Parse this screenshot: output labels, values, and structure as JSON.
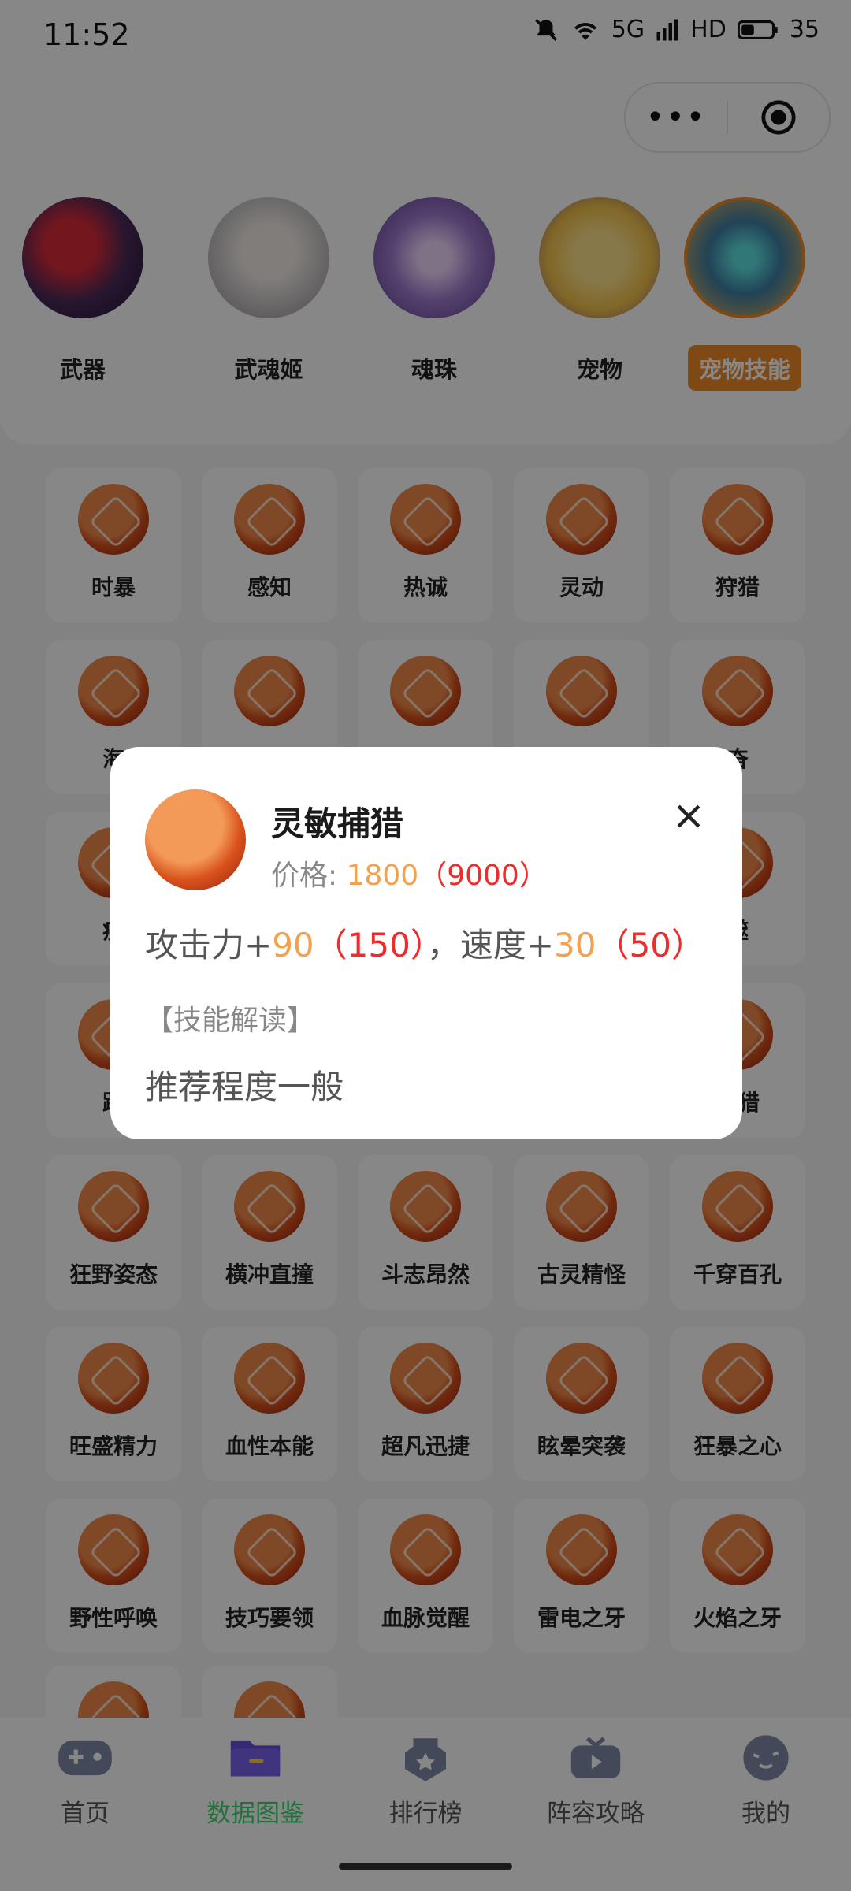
{
  "status": {
    "time": "11:52",
    "network": "5G",
    "hd": "HD",
    "battery": "35"
  },
  "navbar": {
    "more_icon": "more-dots-icon",
    "target_icon": "target-icon"
  },
  "categories": [
    {
      "label": "武器",
      "color": "#4a2a5a"
    },
    {
      "label": "武魂姬",
      "color": "#c9c4c6"
    },
    {
      "label": "魂珠",
      "color": "#a07bd0"
    },
    {
      "label": "宠物",
      "color": "#f3c24a"
    },
    {
      "label": "宠物技能",
      "color": "#3f7fa3",
      "active": true
    }
  ],
  "skills": [
    [
      "时暴",
      "感知",
      "热诚",
      "灵动",
      "狩猎"
    ],
    [
      "海",
      "",
      "",
      "",
      "奋"
    ],
    [
      "疾",
      "",
      "",
      "",
      "噬"
    ],
    [
      "践",
      "",
      "",
      "",
      "捕猎"
    ],
    [
      "狂野姿态",
      "横冲直撞",
      "斗志昂然",
      "古灵精怪",
      "千穿百孔"
    ],
    [
      "旺盛精力",
      "血性本能",
      "超凡迅捷",
      "眩晕突袭",
      "狂暴之心"
    ],
    [
      "野性呼唤",
      "技巧要领",
      "血脉觉醒",
      "雷电之牙",
      "火焰之牙"
    ]
  ],
  "tabbar": [
    {
      "label": "首页",
      "icon": "gamepad-icon"
    },
    {
      "label": "数据图鉴",
      "icon": "folder-icon",
      "active": true
    },
    {
      "label": "排行榜",
      "icon": "badge-icon"
    },
    {
      "label": "阵容攻略",
      "icon": "tv-icon"
    },
    {
      "label": "我的",
      "icon": "face-icon"
    }
  ],
  "dialog": {
    "title": "灵敏捕猎",
    "price_label": "价格:",
    "price": "1800",
    "price_max": "（9000）",
    "stats": {
      "attack_label": "攻击力+",
      "attack": "90",
      "attack_max": "（150）",
      "sep": "，",
      "speed_label": "速度+",
      "speed": "30",
      "speed_max": "（50）"
    },
    "section": "【技能解读】",
    "description": "推荐程度一般"
  }
}
